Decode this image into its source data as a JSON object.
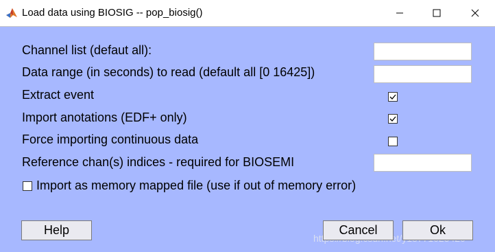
{
  "window": {
    "title": "Load data using BIOSIG -- pop_biosig()",
    "app_icon": "matlab-icon"
  },
  "form": {
    "channel_list_label": "Channel list (defaut all):",
    "channel_list_value": "",
    "data_range_label": "Data range (in seconds) to read (default all [0 16425])",
    "data_range_value": "",
    "extract_event_label": "Extract event",
    "extract_event_checked": true,
    "import_annotations_label": "Import anotations (EDF+ only)",
    "import_annotations_checked": true,
    "force_continuous_label": "Force importing continuous data",
    "force_continuous_checked": false,
    "reference_label": "Reference chan(s) indices - required for BIOSEMI",
    "reference_value": "",
    "memory_mapped_label": "Import as memory mapped file (use if out of memory error)",
    "memory_mapped_checked": false
  },
  "buttons": {
    "help": "Help",
    "cancel": "Cancel",
    "ok": "Ok"
  },
  "watermark": "https://blog.csdn.net/y18771025420",
  "colors": {
    "background": "#a7b8ff",
    "titlebar": "#ffffff"
  }
}
